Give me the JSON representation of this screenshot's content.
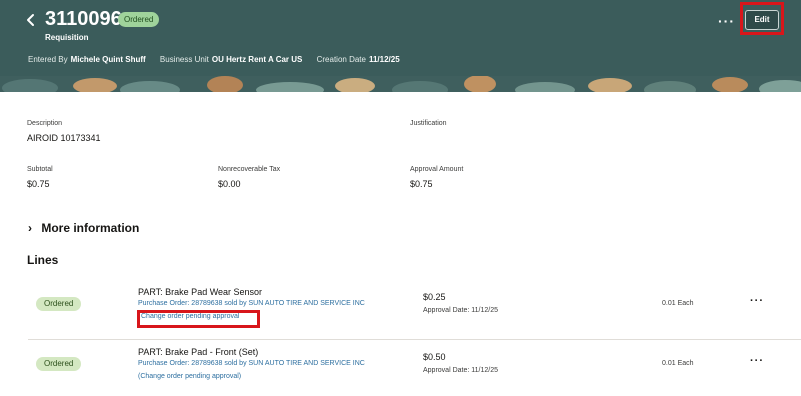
{
  "header": {
    "requisition_number": "3110096",
    "status": "Ordered",
    "type_label": "Requisition",
    "entered_by_label": "Entered By",
    "entered_by": "Michele Quint Shuff",
    "business_unit_label": "Business Unit",
    "business_unit": "OU Hertz Rent A Car US",
    "creation_date_label": "Creation Date",
    "creation_date": "11/12/25",
    "more_actions": "···",
    "edit_label": "Edit",
    "colors": {
      "banner": "#3b5c5b",
      "status_pill": "#9fd39b",
      "highlight": "#d8161b"
    }
  },
  "summary": {
    "description_label": "Description",
    "description": "AIROID 10173341",
    "justification_label": "Justification",
    "subtotal_label": "Subtotal",
    "subtotal": "$0.75",
    "nonrecoverable_tax_label": "Nonrecoverable Tax",
    "nonrecoverable_tax": "$0.00",
    "approval_amount_label": "Approval Amount",
    "approval_amount": "$0.75"
  },
  "more_information": "More information",
  "lines_title": "Lines",
  "lines": [
    {
      "status": "Ordered",
      "title": "PART: Brake Pad Wear Sensor",
      "purchase_order": "Purchase Order: 28789638 sold by SUN AUTO TIRE AND SERVICE INC",
      "change_order": "Change order pending approval",
      "amount": "$0.25",
      "approval_date": "Approval Date: 11/12/25",
      "quantity": "0.01 Each",
      "menu": "···"
    },
    {
      "status": "Ordered",
      "title": "PART: Brake Pad - Front (Set)",
      "purchase_order": "Purchase Order: 28789638 sold by SUN AUTO TIRE AND SERVICE INC",
      "change_order": "(Change order pending approval)",
      "amount": "$0.50",
      "approval_date": "Approval Date: 11/12/25",
      "quantity": "0.01 Each",
      "menu": "···"
    }
  ]
}
